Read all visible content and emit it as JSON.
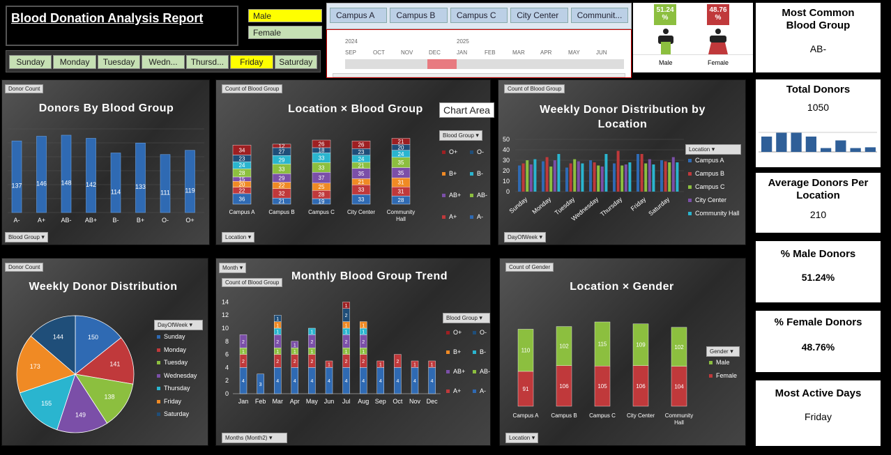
{
  "report_title": "Blood Donation Analysis Report",
  "gender_slicer": {
    "options": [
      "Male",
      "Female"
    ],
    "selected": "Male"
  },
  "day_slicer": {
    "options": [
      "Sunday",
      "Monday",
      "Tuesday",
      "Wedn...",
      "Thursd...",
      "Friday",
      "Saturday"
    ],
    "selected": "Friday"
  },
  "location_slicer": {
    "options": [
      "Campus A",
      "Campus B",
      "Campus C",
      "City Center",
      "Communit..."
    ]
  },
  "timeline": {
    "years": [
      "2024",
      "2025"
    ],
    "months": [
      "SEP",
      "OCT",
      "NOV",
      "DEC",
      "JAN",
      "FEB",
      "MAR",
      "APR",
      "MAY",
      "JUN"
    ],
    "selected": "DEC"
  },
  "gender_panel": {
    "male_pct": "51.24 %",
    "female_pct": "48.76 %",
    "male_label": "Male",
    "female_label": "Female"
  },
  "kpis": [
    {
      "title": "Most Common Blood Group",
      "value": "AB-"
    },
    {
      "title": "Total Donors",
      "value": "1050",
      "spark": [
        4,
        5,
        5,
        4,
        1,
        3,
        1,
        1.2
      ]
    },
    {
      "title": "Average Donors Per Location",
      "value": "210"
    },
    {
      "title": "% Male Donors",
      "value": "51.24%"
    },
    {
      "title": "% Female Donors",
      "value": "48.76%"
    },
    {
      "title": "Most Active Days",
      "value": "Friday"
    }
  ],
  "tooltip": "Chart Area",
  "colors": {
    "blue": "#2f6ab3",
    "red": "#c0393b",
    "orange": "#f08a24",
    "teal": "#2ab5cf",
    "green": "#8cbf3f",
    "purple": "#7b4fa8",
    "darkblue": "#1f4e79",
    "darkred": "#9e1f22"
  },
  "chart1": {
    "title": "Donors By Blood Group",
    "filter": "Donor Count",
    "axis_filter": "Blood Group",
    "categories": [
      "A-",
      "A+",
      "AB-",
      "AB+",
      "B-",
      "B+",
      "O-",
      "O+"
    ],
    "values": [
      137,
      146,
      148,
      142,
      114,
      133,
      111,
      119
    ]
  },
  "chart2": {
    "title": "Location × Blood Group",
    "filter": "Count of Blood Group",
    "axis_filter": "Location",
    "legend_filter": "Blood Group",
    "categories": [
      "Campus A",
      "Campus B",
      "Campus C",
      "City Center",
      "Community Hall"
    ],
    "series": [
      {
        "name": "A+",
        "values": [
          36,
          21,
          19,
          33,
          28
        ]
      },
      {
        "name": "O+",
        "values": [
          22,
          32,
          28,
          33,
          31
        ]
      },
      {
        "name": "A-",
        "values": [
          20,
          22,
          25,
          21,
          31
        ]
      },
      {
        "name": "AB+",
        "values": [
          15,
          29,
          37,
          35,
          35
        ]
      },
      {
        "name": "AB-",
        "values": [
          28,
          33,
          33,
          21,
          35
        ]
      },
      {
        "name": "B+",
        "values": [
          24,
          29,
          33,
          24,
          24
        ]
      },
      {
        "name": "B-",
        "values": [
          23,
          27,
          18,
          23,
          20
        ]
      },
      {
        "name": "O-",
        "values": [
          34,
          12,
          26,
          26,
          21
        ]
      }
    ],
    "legend": [
      "O+",
      "O-",
      "B+",
      "B-",
      "AB+",
      "AB-",
      "A+",
      "A-"
    ]
  },
  "chart3": {
    "title": "Weekly Donor Distribution by Location",
    "filter": "Count of Blood Group",
    "axis_filter": "DayOfWeek",
    "legend_filter": "Location",
    "ylim": [
      0,
      50
    ],
    "yticks": [
      0,
      10,
      20,
      30,
      40,
      50
    ],
    "categories": [
      "Sunday",
      "Monday",
      "Tuesday",
      "Wednesday",
      "Thursday",
      "Friday",
      "Saturday"
    ],
    "series": [
      {
        "name": "Campus A"
      },
      {
        "name": "Campus B"
      },
      {
        "name": "Campus C"
      },
      {
        "name": "City Center"
      },
      {
        "name": "Community Hall"
      }
    ]
  },
  "chart4": {
    "title": "Weekly Donor Distribution",
    "filter": "Donor Count",
    "legend_filter": "DayOfWeek",
    "labels": [
      "Sunday",
      "Monday",
      "Tuesday",
      "Wednesday",
      "Thursday",
      "Friday",
      "Saturday"
    ],
    "values": [
      150,
      141,
      138,
      149,
      155,
      173,
      144
    ]
  },
  "chart5": {
    "title": "Monthly Blood Group Trend",
    "filter": "Count of Blood Group",
    "month_filter": "Month",
    "axis_filter": "Months (Month2)",
    "legend_filter": "Blood Group",
    "ylim": [
      0,
      14
    ],
    "yticks": [
      0,
      2,
      4,
      6,
      8,
      10,
      12,
      14
    ],
    "categories": [
      "Jan",
      "Feb",
      "Mar",
      "Apr",
      "May",
      "Jun",
      "Jul",
      "Aug",
      "Sep",
      "Oct",
      "Nov",
      "Dec"
    ],
    "totals": [
      9,
      3,
      12,
      8,
      10,
      5,
      14,
      11,
      5,
      6,
      5,
      5
    ],
    "legend": [
      "O+",
      "O-",
      "B+",
      "B-",
      "AB+",
      "AB-",
      "A+",
      "A-"
    ]
  },
  "chart6": {
    "title": "Location × Gender",
    "filter": "Count of Gender",
    "axis_filter": "Location",
    "legend_filter": "Gender",
    "categories": [
      "Campus A",
      "Campus B",
      "Campus C",
      "City Center",
      "Community Hall"
    ],
    "series": [
      {
        "name": "Female",
        "values": [
          91,
          106,
          105,
          106,
          104
        ]
      },
      {
        "name": "Male",
        "values": [
          110,
          102,
          115,
          109,
          102
        ]
      }
    ]
  }
}
